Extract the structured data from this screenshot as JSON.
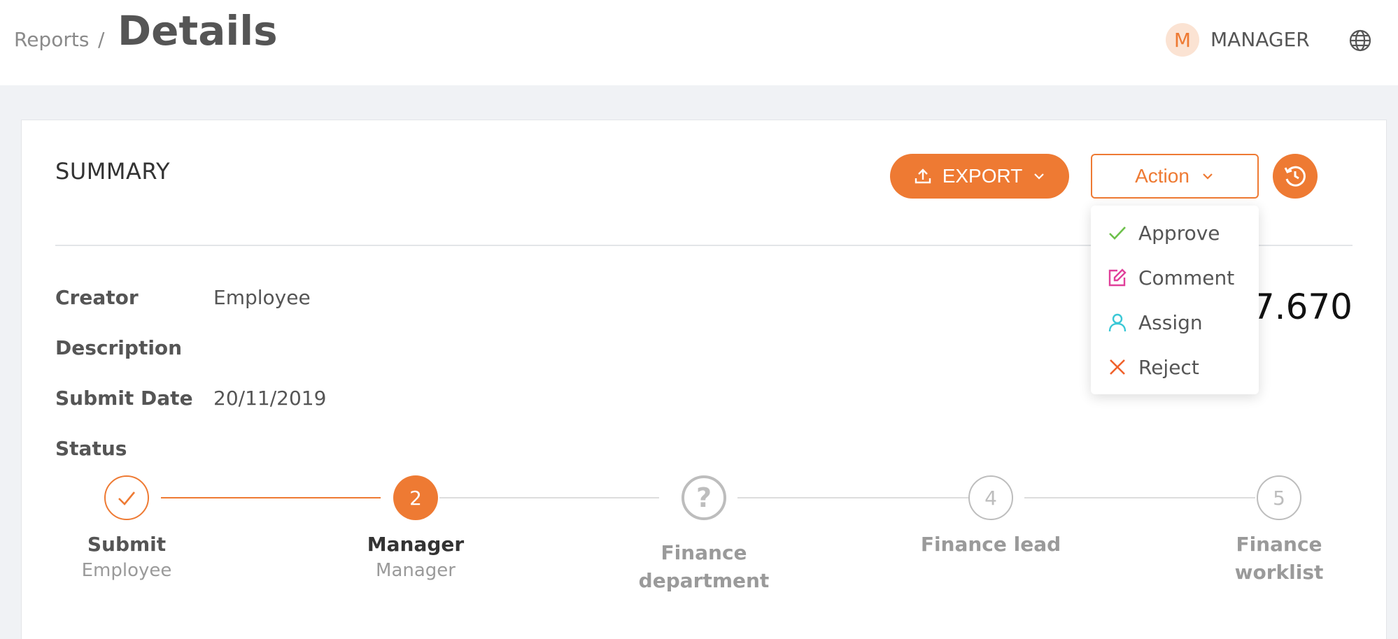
{
  "header": {
    "breadcrumb_parent": "Reports",
    "breadcrumb_separator": "/",
    "title": "Details",
    "avatar_initial": "M",
    "username": "MANAGER",
    "globe_icon": "globe-icon"
  },
  "summary": {
    "title": "SUMMARY",
    "export_label": "EXPORT",
    "action_label": "Action",
    "history_icon": "history-icon",
    "amount_visible": "37.670"
  },
  "fields": [
    {
      "label": "Creator",
      "value": "Employee"
    },
    {
      "label": "Description",
      "value": ""
    },
    {
      "label": "Submit Date",
      "value": "20/11/2019"
    },
    {
      "label": "Status",
      "value": ""
    }
  ],
  "action_menu": [
    {
      "label": "Approve",
      "icon": "check-icon",
      "color": "#6cc04a"
    },
    {
      "label": "Comment",
      "icon": "edit-icon",
      "color": "#e0409a"
    },
    {
      "label": "Assign",
      "icon": "user-icon",
      "color": "#3ac8d6"
    },
    {
      "label": "Reject",
      "icon": "close-icon",
      "color": "#f0602a"
    }
  ],
  "steps": [
    {
      "badge": "",
      "state": "done",
      "title": "Submit",
      "subtitle": "Employee"
    },
    {
      "badge": "2",
      "state": "active",
      "title": "Manager",
      "subtitle": "Manager"
    },
    {
      "badge": "?",
      "state": "unknown",
      "title": "Finance department",
      "subtitle": ""
    },
    {
      "badge": "4",
      "state": "pending",
      "title": "Finance lead",
      "subtitle": ""
    },
    {
      "badge": "5",
      "state": "pending",
      "title": "Finance worklist",
      "subtitle": ""
    }
  ],
  "colors": {
    "accent": "#ee7a33",
    "muted": "#bdbdbd",
    "text": "#555555"
  }
}
